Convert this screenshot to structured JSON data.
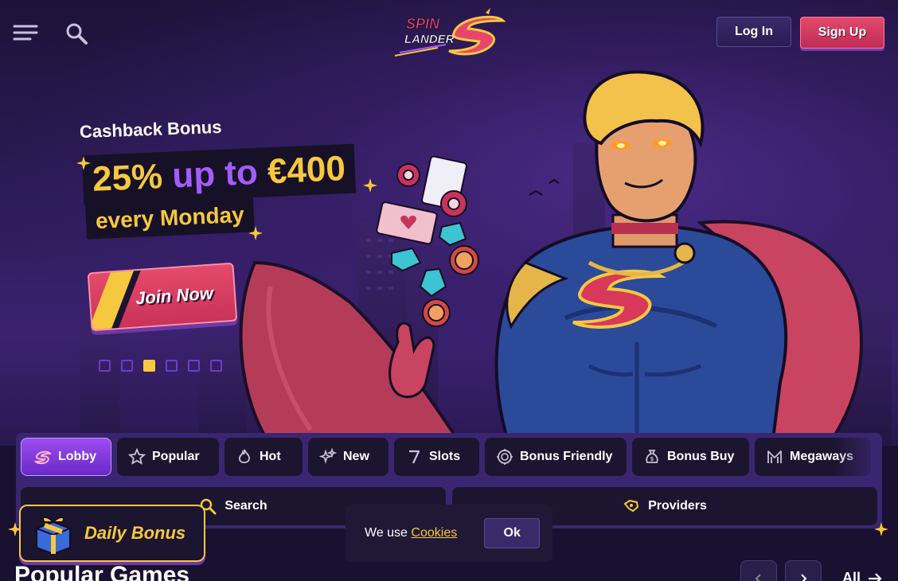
{
  "header": {
    "logo_line1": "SPIN",
    "logo_line2": "LANDER",
    "login_label": "Log In",
    "signup_label": "Sign Up"
  },
  "promo": {
    "label": "Cashback Bonus",
    "headline_part1": "25%",
    "headline_part2": "up to",
    "headline_part3": "€400",
    "sub": "every Monday",
    "cta": "Join Now",
    "slide_count": 6,
    "active_slide": 3
  },
  "categories": [
    {
      "label": "Lobby",
      "icon": "spin-logo-icon",
      "active": true
    },
    {
      "label": "Popular",
      "icon": "star-icon",
      "active": false
    },
    {
      "label": "Hot",
      "icon": "flame-icon",
      "active": false
    },
    {
      "label": "New",
      "icon": "sparkles-icon",
      "active": false
    },
    {
      "label": "Slots",
      "icon": "seven-icon",
      "active": false
    },
    {
      "label": "Bonus Friendly",
      "icon": "coin-target-icon",
      "active": false
    },
    {
      "label": "Bonus Buy",
      "icon": "money-bag-icon",
      "active": false
    },
    {
      "label": "Megaways",
      "icon": "megaways-m-icon",
      "active": false
    }
  ],
  "search": {
    "search_label": "Search",
    "providers_label": "Providers"
  },
  "daily_bonus": {
    "label": "Daily Bonus"
  },
  "cookie": {
    "text": "We use",
    "link": "Cookies",
    "ok": "Ok"
  },
  "section": {
    "title": "Popular Games",
    "all_label": "All"
  },
  "colors": {
    "accent_yellow": "#f6c840",
    "accent_purple": "#a45bff",
    "signup_red": "#e24a6c",
    "panel_purple": "#3a2670"
  }
}
